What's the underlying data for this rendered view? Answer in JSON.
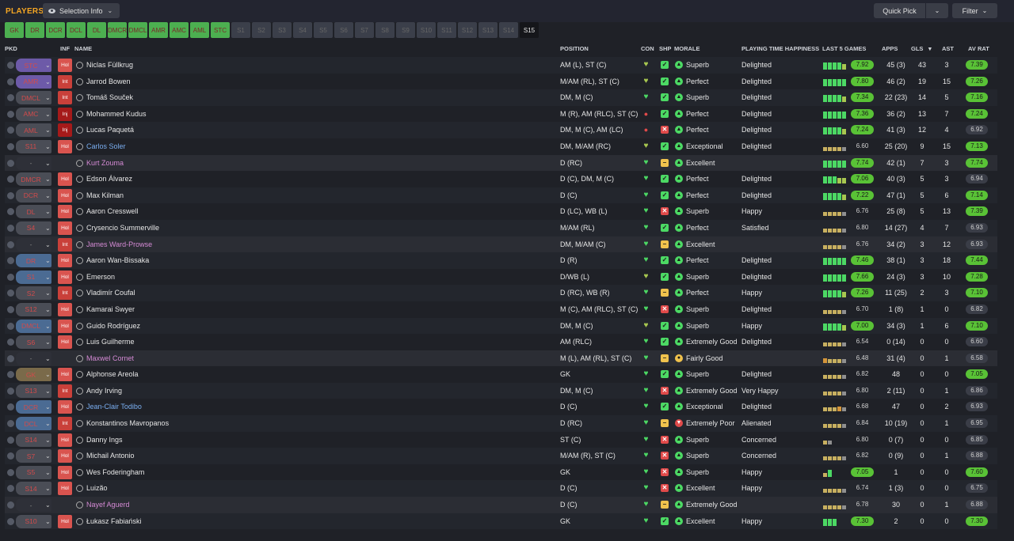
{
  "title": "PLAYERS",
  "selection_info": "Selection Info",
  "quick_pick": "Quick Pick",
  "filter": "Filter",
  "tabs": [
    {
      "label": "GK",
      "state": "fill"
    },
    {
      "label": "DR",
      "state": "fill"
    },
    {
      "label": "DCR",
      "state": "fill"
    },
    {
      "label": "DCL",
      "state": "fill"
    },
    {
      "label": "DL",
      "state": "fill"
    },
    {
      "label": "DMCR",
      "state": "fill"
    },
    {
      "label": "DMCL",
      "state": "fill"
    },
    {
      "label": "AMR",
      "state": "fill"
    },
    {
      "label": "AMC",
      "state": "fill"
    },
    {
      "label": "AML",
      "state": "fill"
    },
    {
      "label": "STC",
      "state": "fill"
    },
    {
      "label": "S1",
      "state": "empty"
    },
    {
      "label": "S2",
      "state": "empty"
    },
    {
      "label": "S3",
      "state": "empty"
    },
    {
      "label": "S4",
      "state": "empty"
    },
    {
      "label": "S5",
      "state": "empty"
    },
    {
      "label": "S6",
      "state": "empty"
    },
    {
      "label": "S7",
      "state": "empty"
    },
    {
      "label": "S8",
      "state": "empty"
    },
    {
      "label": "S9",
      "state": "empty"
    },
    {
      "label": "S10",
      "state": "empty"
    },
    {
      "label": "S11",
      "state": "empty"
    },
    {
      "label": "S12",
      "state": "empty"
    },
    {
      "label": "S13",
      "state": "empty"
    },
    {
      "label": "S14",
      "state": "empty"
    },
    {
      "label": "S15",
      "state": "active"
    }
  ],
  "columns": {
    "pkd": "PKD",
    "inf": "INF",
    "name": "NAME",
    "position": "POSITION",
    "con": "CON",
    "shp": "SHP",
    "morale": "MORALE",
    "pth": "PLAYING TIME HAPPINESS",
    "last5": "LAST 5 GAMES",
    "apps": "APPS",
    "gls": "GLS",
    "ast": "AST",
    "avrat": "AV RAT"
  },
  "players": [
    {
      "pick": "STC",
      "kind": "att",
      "inf": "Hol",
      "name": "Niclas Füllkrug",
      "nc": "",
      "pos": "AM (L), ST (C)",
      "con": "heartd",
      "shp": "g",
      "mi": "g",
      "morale": "Superb",
      "pth": "Delighted",
      "form": "ggggl",
      "last": "7.92",
      "lh": true,
      "apps": "45 (3)",
      "gls": "43",
      "ast": "3",
      "av": "7.39",
      "ah": true,
      "dim": false
    },
    {
      "pick": "AMR",
      "kind": "att",
      "inf": "Int",
      "name": "Jarrod Bowen",
      "nc": "",
      "pos": "M/AM (RL), ST (C)",
      "con": "heartd",
      "shp": "g",
      "mi": "g",
      "morale": "Perfect",
      "pth": "Delighted",
      "form": "ggggg",
      "last": "7.80",
      "lh": true,
      "apps": "46 (2)",
      "gls": "19",
      "ast": "15",
      "av": "7.26",
      "ah": true,
      "dim": false
    },
    {
      "pick": "DMCL",
      "kind": "mid",
      "inf": "Int",
      "name": "Tomáš Souček",
      "nc": "",
      "pos": "DM, M (C)",
      "con": "heart",
      "shp": "g",
      "mi": "g",
      "morale": "Superb",
      "pth": "Delighted",
      "form": "ggggl",
      "last": "7.34",
      "lh": true,
      "apps": "22 (23)",
      "gls": "14",
      "ast": "5",
      "av": "7.16",
      "ah": true,
      "dim": false
    },
    {
      "pick": "AMC",
      "kind": "mid",
      "inf": "Inj",
      "name": "Mohammed Kudus",
      "nc": "",
      "pos": "M (R), AM (RLC), ST (C)",
      "con": "dot",
      "shp": "g",
      "mi": "g",
      "morale": "Perfect",
      "pth": "Delighted",
      "form": "ggggg",
      "last": "7.36",
      "lh": true,
      "apps": "36 (2)",
      "gls": "13",
      "ast": "7",
      "av": "7.24",
      "ah": true,
      "dim": false
    },
    {
      "pick": "AML",
      "kind": "mid",
      "inf": "Inj",
      "name": "Lucas Paquetá",
      "nc": "",
      "pos": "DM, M (C), AM (LC)",
      "con": "dot",
      "shp": "r",
      "mi": "g",
      "morale": "Perfect",
      "pth": "Delighted",
      "form": "ggggl",
      "last": "7.24",
      "lh": true,
      "apps": "41 (3)",
      "gls": "12",
      "ast": "4",
      "av": "6.92",
      "ah": false,
      "dim": false
    },
    {
      "pick": "S11",
      "kind": "mid",
      "inf": "Hol",
      "name": "Carlos Soler",
      "nc": "loan-blue",
      "pos": "DM, M/AM (RC)",
      "con": "heartd",
      "shp": "g",
      "mi": "g",
      "morale": "Exceptional",
      "pth": "Delighted",
      "form": "yyyyn",
      "last": "6.60",
      "lh": false,
      "apps": "25 (20)",
      "gls": "9",
      "ast": "15",
      "av": "7.13",
      "ah": true,
      "dim": false
    },
    {
      "pick": "-",
      "kind": "none",
      "inf": "",
      "name": "Kurt Zouma",
      "nc": "loan-pink",
      "pos": "D (RC)",
      "con": "heart",
      "shp": "y",
      "mi": "g",
      "morale": "Excellent",
      "pth": "",
      "form": "ggggg",
      "last": "7.74",
      "lh": true,
      "apps": "42 (1)",
      "gls": "7",
      "ast": "3",
      "av": "7.74",
      "ah": true,
      "dim": true
    },
    {
      "pick": "DMCR",
      "kind": "mid",
      "inf": "Hol",
      "name": "Edson Álvarez",
      "nc": "",
      "pos": "D (C), DM, M (C)",
      "con": "heart",
      "shp": "g",
      "mi": "g",
      "morale": "Perfect",
      "pth": "Delighted",
      "form": "gggll",
      "last": "7.06",
      "lh": true,
      "apps": "40 (3)",
      "gls": "5",
      "ast": "3",
      "av": "6.94",
      "ah": false,
      "dim": false
    },
    {
      "pick": "DCR",
      "kind": "mid",
      "inf": "Hol",
      "name": "Max Kilman",
      "nc": "",
      "pos": "D (C)",
      "con": "heart",
      "shp": "g",
      "mi": "g",
      "morale": "Perfect",
      "pth": "Delighted",
      "form": "ggggl",
      "last": "7.22",
      "lh": true,
      "apps": "47 (1)",
      "gls": "5",
      "ast": "6",
      "av": "7.14",
      "ah": true,
      "dim": false
    },
    {
      "pick": "DL",
      "kind": "mid",
      "inf": "Hol",
      "name": "Aaron Cresswell",
      "nc": "",
      "pos": "D (LC), WB (L)",
      "con": "heart",
      "shp": "r",
      "mi": "g",
      "morale": "Superb",
      "pth": "Happy",
      "form": "yyyyn",
      "last": "6.76",
      "lh": false,
      "apps": "25 (8)",
      "gls": "5",
      "ast": "13",
      "av": "7.39",
      "ah": true,
      "dim": false
    },
    {
      "pick": "S4",
      "kind": "mid",
      "inf": "Hol",
      "name": "Crysencio Summerville",
      "nc": "",
      "pos": "M/AM (RL)",
      "con": "heart",
      "shp": "g",
      "mi": "g",
      "morale": "Perfect",
      "pth": "Satisfied",
      "form": "yyyyn",
      "last": "6.80",
      "lh": false,
      "apps": "14 (27)",
      "gls": "4",
      "ast": "7",
      "av": "6.93",
      "ah": false,
      "dim": false
    },
    {
      "pick": "-",
      "kind": "none",
      "inf": "Int",
      "name": "James Ward-Prowse",
      "nc": "loan-pink",
      "pos": "DM, M/AM (C)",
      "con": "heart",
      "shp": "y",
      "mi": "g",
      "morale": "Excellent",
      "pth": "",
      "form": "yyyyn",
      "last": "6.76",
      "lh": false,
      "apps": "34 (2)",
      "gls": "3",
      "ast": "12",
      "av": "6.93",
      "ah": false,
      "dim": true
    },
    {
      "pick": "DR",
      "kind": "def",
      "inf": "Hol",
      "name": "Aaron Wan-Bissaka",
      "nc": "",
      "pos": "D (R)",
      "con": "heart",
      "shp": "g",
      "mi": "g",
      "morale": "Perfect",
      "pth": "Delighted",
      "form": "ggggg",
      "last": "7.46",
      "lh": true,
      "apps": "38 (1)",
      "gls": "3",
      "ast": "18",
      "av": "7.44",
      "ah": true,
      "dim": false
    },
    {
      "pick": "S1",
      "kind": "def",
      "inf": "Hol",
      "name": "Emerson",
      "nc": "",
      "pos": "D/WB (L)",
      "con": "heartd",
      "shp": "g",
      "mi": "g",
      "morale": "Superb",
      "pth": "Delighted",
      "form": "ggggg",
      "last": "7.66",
      "lh": true,
      "apps": "24 (3)",
      "gls": "3",
      "ast": "10",
      "av": "7.28",
      "ah": true,
      "dim": false
    },
    {
      "pick": "S2",
      "kind": "mid",
      "inf": "Int",
      "name": "Vladimír Coufal",
      "nc": "",
      "pos": "D (RC), WB (R)",
      "con": "heart",
      "shp": "y",
      "mi": "g",
      "morale": "Perfect",
      "pth": "Happy",
      "form": "ggggl",
      "last": "7.26",
      "lh": true,
      "apps": "11 (25)",
      "gls": "2",
      "ast": "3",
      "av": "7.10",
      "ah": true,
      "dim": false
    },
    {
      "pick": "S12",
      "kind": "mid",
      "inf": "Hol",
      "name": "Kamarai Swyer",
      "nc": "",
      "pos": "M (C), AM (RLC), ST (C)",
      "con": "heart",
      "shp": "r",
      "mi": "g",
      "morale": "Superb",
      "pth": "Delighted",
      "form": "yyyyn",
      "last": "6.70",
      "lh": false,
      "apps": "1 (8)",
      "gls": "1",
      "ast": "0",
      "av": "6.82",
      "ah": false,
      "dim": false
    },
    {
      "pick": "DMCL",
      "kind": "def",
      "inf": "Hol",
      "name": "Guido Rodríguez",
      "nc": "",
      "pos": "DM, M (C)",
      "con": "heartd",
      "shp": "g",
      "mi": "g",
      "morale": "Superb",
      "pth": "Happy",
      "form": "ggggl",
      "last": "7.00",
      "lh": true,
      "apps": "34 (3)",
      "gls": "1",
      "ast": "6",
      "av": "7.10",
      "ah": true,
      "dim": false
    },
    {
      "pick": "S6",
      "kind": "mid",
      "inf": "Hol",
      "name": "Luis Guilherme",
      "nc": "",
      "pos": "AM (RLC)",
      "con": "heart",
      "shp": "g",
      "mi": "g",
      "morale": "Extremely Good",
      "pth": "Delighted",
      "form": "yyyyn",
      "last": "6.54",
      "lh": false,
      "apps": "0 (14)",
      "gls": "0",
      "ast": "0",
      "av": "6.60",
      "ah": false,
      "dim": false
    },
    {
      "pick": "-",
      "kind": "none",
      "inf": "",
      "name": "Maxwel Cornet",
      "nc": "loan-pink",
      "pos": "M (L), AM (RL), ST (C)",
      "con": "heart",
      "shp": "y",
      "mi": "y",
      "morale": "Fairly Good",
      "pth": "",
      "form": "oyyyn",
      "last": "6.48",
      "lh": false,
      "apps": "31 (4)",
      "gls": "0",
      "ast": "1",
      "av": "6.58",
      "ah": false,
      "dim": true
    },
    {
      "pick": "GK",
      "kind": "gk",
      "inf": "Hol",
      "name": "Alphonse Areola",
      "nc": "",
      "pos": "GK",
      "con": "heart",
      "shp": "g",
      "mi": "g",
      "morale": "Superb",
      "pth": "Delighted",
      "form": "yyyyn",
      "last": "6.82",
      "lh": false,
      "apps": "48",
      "gls": "0",
      "ast": "0",
      "av": "7.05",
      "ah": true,
      "dim": false
    },
    {
      "pick": "S13",
      "kind": "mid",
      "inf": "Int",
      "name": "Andy Irving",
      "nc": "",
      "pos": "DM, M (C)",
      "con": "heart",
      "shp": "r",
      "mi": "g",
      "morale": "Extremely Good",
      "pth": "Very Happy",
      "form": "yyyyn",
      "last": "6.80",
      "lh": false,
      "apps": "2 (11)",
      "gls": "0",
      "ast": "1",
      "av": "6.86",
      "ah": false,
      "dim": false
    },
    {
      "pick": "DCR",
      "kind": "def",
      "inf": "Hol",
      "name": "Jean-Clair Todibo",
      "nc": "loan-blue",
      "pos": "D (C)",
      "con": "heart",
      "shp": "g",
      "mi": "g",
      "morale": "Exceptional",
      "pth": "Delighted",
      "form": "yyyon",
      "last": "6.68",
      "lh": false,
      "apps": "47",
      "gls": "0",
      "ast": "2",
      "av": "6.93",
      "ah": false,
      "dim": false
    },
    {
      "pick": "DCL",
      "kind": "def",
      "inf": "Int",
      "name": "Konstantinos Mavropanos",
      "nc": "",
      "pos": "D (RC)",
      "con": "heart",
      "shp": "y",
      "mi": "r",
      "morale": "Extremely Poor",
      "pth": "Alienated",
      "form": "yyyyn",
      "last": "6.84",
      "lh": false,
      "apps": "10 (19)",
      "gls": "0",
      "ast": "1",
      "av": "6.95",
      "ah": false,
      "dim": false
    },
    {
      "pick": "S14",
      "kind": "mid",
      "inf": "Hol",
      "name": "Danny Ings",
      "nc": "",
      "pos": "ST (C)",
      "con": "heart",
      "shp": "r",
      "mi": "g",
      "morale": "Superb",
      "pth": "Concerned",
      "form": "yn",
      "last": "6.80",
      "lh": false,
      "apps": "0 (7)",
      "gls": "0",
      "ast": "0",
      "av": "6.85",
      "ah": false,
      "dim": false
    },
    {
      "pick": "S7",
      "kind": "mid",
      "inf": "Hol",
      "name": "Michail Antonio",
      "nc": "",
      "pos": "M/AM (R), ST (C)",
      "con": "heart",
      "shp": "r",
      "mi": "g",
      "morale": "Superb",
      "pth": "Concerned",
      "form": "yyyyn",
      "last": "6.82",
      "lh": false,
      "apps": "0 (9)",
      "gls": "0",
      "ast": "1",
      "av": "6.88",
      "ah": false,
      "dim": false
    },
    {
      "pick": "S5",
      "kind": "mid",
      "inf": "Hol",
      "name": "Wes Foderingham",
      "nc": "",
      "pos": "GK",
      "con": "heart",
      "shp": "r",
      "mi": "g",
      "morale": "Superb",
      "pth": "Happy",
      "form": "yg",
      "last": "7.05",
      "lh": true,
      "apps": "1",
      "gls": "0",
      "ast": "0",
      "av": "7.60",
      "ah": true,
      "dim": false
    },
    {
      "pick": "S14",
      "kind": "mid",
      "inf": "Hol",
      "name": "Luizão",
      "nc": "",
      "pos": "D (C)",
      "con": "heart",
      "shp": "r",
      "mi": "g",
      "morale": "Excellent",
      "pth": "Happy",
      "form": "yyyyn",
      "last": "6.74",
      "lh": false,
      "apps": "1 (3)",
      "gls": "0",
      "ast": "0",
      "av": "6.75",
      "ah": false,
      "dim": false
    },
    {
      "pick": "-",
      "kind": "none",
      "inf": "",
      "name": "Nayef Aguerd",
      "nc": "loan-pink",
      "pos": "D (C)",
      "con": "heart",
      "shp": "y",
      "mi": "g",
      "morale": "Extremely Good",
      "pth": "",
      "form": "yyyyn",
      "last": "6.78",
      "lh": false,
      "apps": "30",
      "gls": "0",
      "ast": "1",
      "av": "6.88",
      "ah": false,
      "dim": true
    },
    {
      "pick": "S10",
      "kind": "mid",
      "inf": "Hol",
      "name": "Łukasz Fabiański",
      "nc": "",
      "pos": "GK",
      "con": "heart",
      "shp": "g",
      "mi": "g",
      "morale": "Excellent",
      "pth": "Happy",
      "form": "ggg",
      "last": "7.30",
      "lh": true,
      "apps": "2",
      "gls": "0",
      "ast": "0",
      "av": "7.30",
      "ah": true,
      "dim": false
    }
  ]
}
